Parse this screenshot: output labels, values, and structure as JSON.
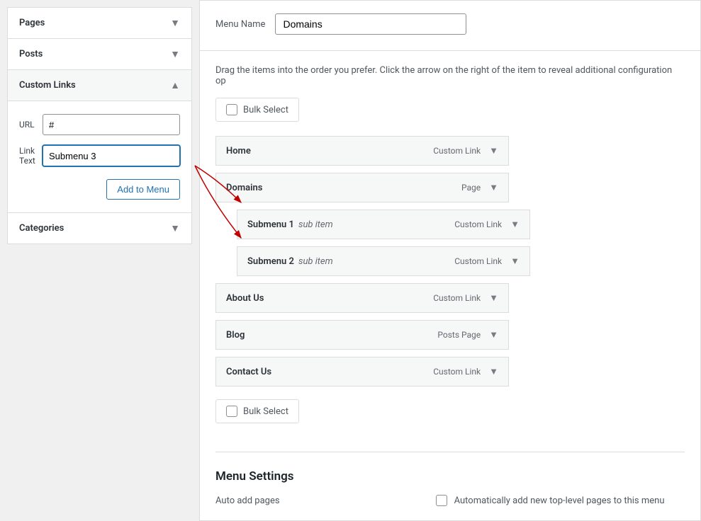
{
  "sidebar": {
    "sections": {
      "pages": {
        "title": "Pages"
      },
      "posts": {
        "title": "Posts"
      },
      "custom_links": {
        "title": "Custom Links",
        "url_label": "URL",
        "url_value": "#",
        "link_text_label": "Link Text",
        "link_text_value": "Submenu 3",
        "add_button": "Add to Menu"
      },
      "categories": {
        "title": "Categories"
      }
    }
  },
  "main": {
    "menu_name_label": "Menu Name",
    "menu_name_value": "Domains",
    "instructions": "Drag the items into the order you prefer. Click the arrow on the right of the item to reveal additional configuration op",
    "bulk_select_label": "Bulk Select",
    "items": [
      {
        "title": "Home",
        "type": "Custom Link",
        "sub": false,
        "indented": false
      },
      {
        "title": "Domains",
        "type": "Page",
        "sub": false,
        "indented": false
      },
      {
        "title": "Submenu 1",
        "type": "Custom Link",
        "sub": true,
        "indented": true
      },
      {
        "title": "Submenu 2",
        "type": "Custom Link",
        "sub": true,
        "indented": true
      },
      {
        "title": "About Us",
        "type": "Custom Link",
        "sub": false,
        "indented": false
      },
      {
        "title": "Blog",
        "type": "Posts Page",
        "sub": false,
        "indented": false
      },
      {
        "title": "Contact Us",
        "type": "Custom Link",
        "sub": false,
        "indented": false
      }
    ],
    "sub_item_label": "sub item",
    "settings": {
      "title": "Menu Settings",
      "auto_add_label": "Auto add pages",
      "auto_add_option": "Automatically add new top-level pages to this menu"
    }
  }
}
